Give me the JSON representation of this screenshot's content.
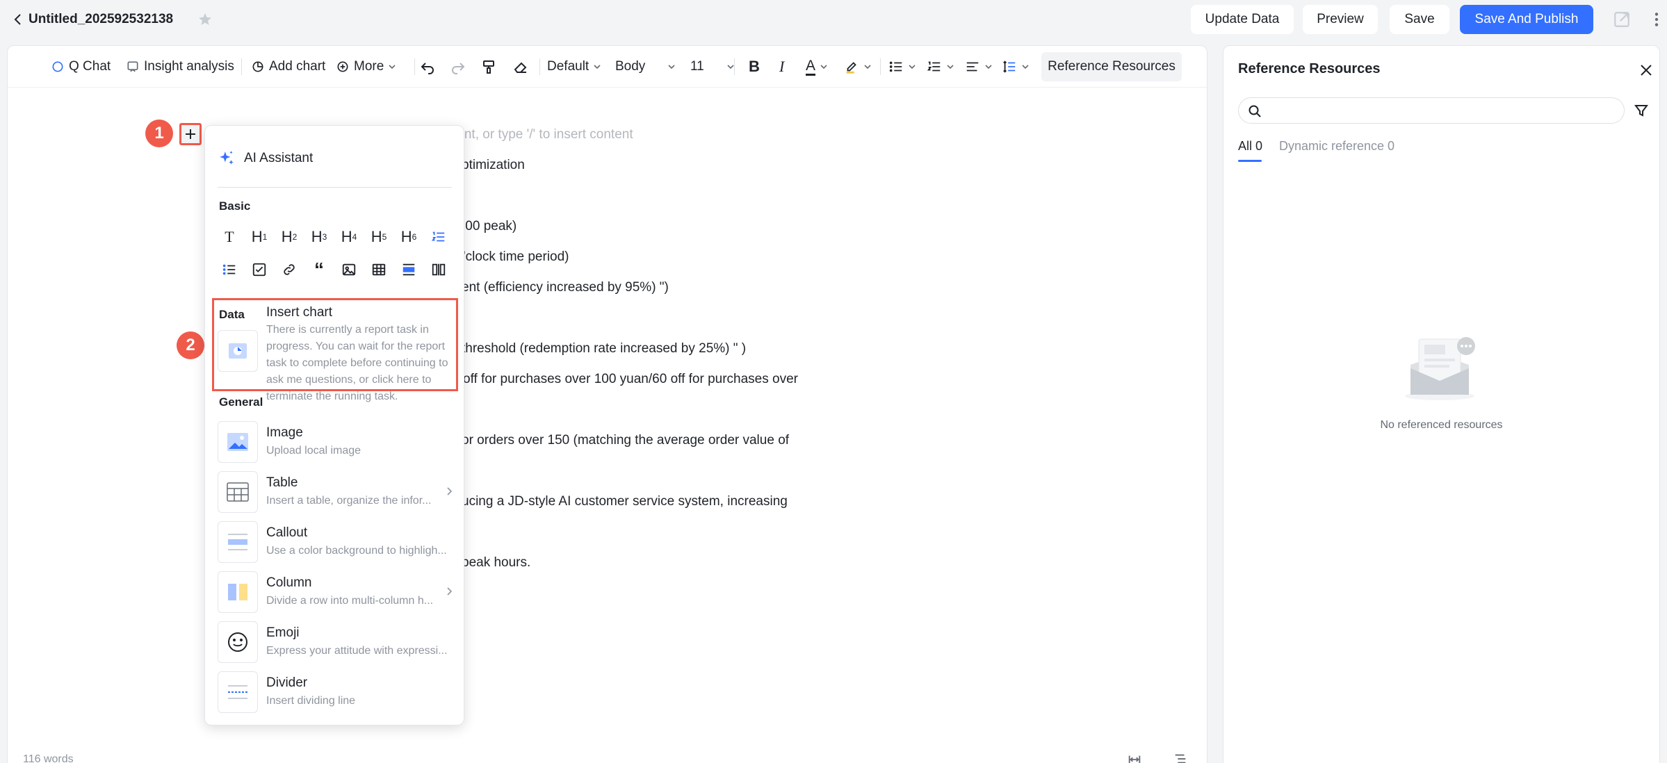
{
  "header": {
    "title": "Untitled_202592532138",
    "buttons": {
      "update": "Update Data",
      "preview": "Preview",
      "save": "Save",
      "publish": "Save And Publish"
    }
  },
  "toolbar": {
    "q_chat": "Q Chat",
    "insight": "Insight analysis",
    "add_chart": "Add chart",
    "more": "More",
    "style": "Default",
    "text_style": "Body",
    "font_size": "11",
    "reference": "Reference Resources"
  },
  "editor": {
    "placeholder_fragment": "tant, or type '/' to insert content",
    "lines": [
      "ptimization",
      ":00 peak)",
      "'clock time period)",
      "ent (efficiency increased by 95%) \")",
      "threshold (redemption rate increased by 25%) \" )",
      "off for purchases over 100 yuan/60 off for purchases over",
      "or orders over 150 (matching the average order value of",
      "ucing a JD-style AI customer service system, increasing",
      "peak hours."
    ],
    "word_count": "116 words"
  },
  "badges": {
    "one": "1",
    "two": "2"
  },
  "menu": {
    "ai": "AI Assistant",
    "basic": "Basic",
    "data": "Data",
    "general": "General",
    "insert_chart_title": "Insert chart",
    "insert_chart_desc": "There is currently a report task in progress. You can wait for the report task to complete before continuing to ask me questions, or click here to terminate the running task.",
    "items": [
      {
        "title": "Image",
        "desc": "Upload local image"
      },
      {
        "title": "Table",
        "desc": "Insert a table, organize the infor..."
      },
      {
        "title": "Callout",
        "desc": "Use a color background to highligh..."
      },
      {
        "title": "Column",
        "desc": "Divide a row into multi-column h..."
      },
      {
        "title": "Emoji",
        "desc": "Express your attitude with expressi..."
      },
      {
        "title": "Divider",
        "desc": "Insert dividing line"
      }
    ]
  },
  "side": {
    "title": "Reference Resources",
    "search_placeholder": "",
    "tab_all": "All 0",
    "tab_dynamic": "Dynamic reference 0",
    "empty": "No referenced resources"
  },
  "colors": {
    "accent": "#3370ff",
    "highlight": "#f05a4a"
  }
}
